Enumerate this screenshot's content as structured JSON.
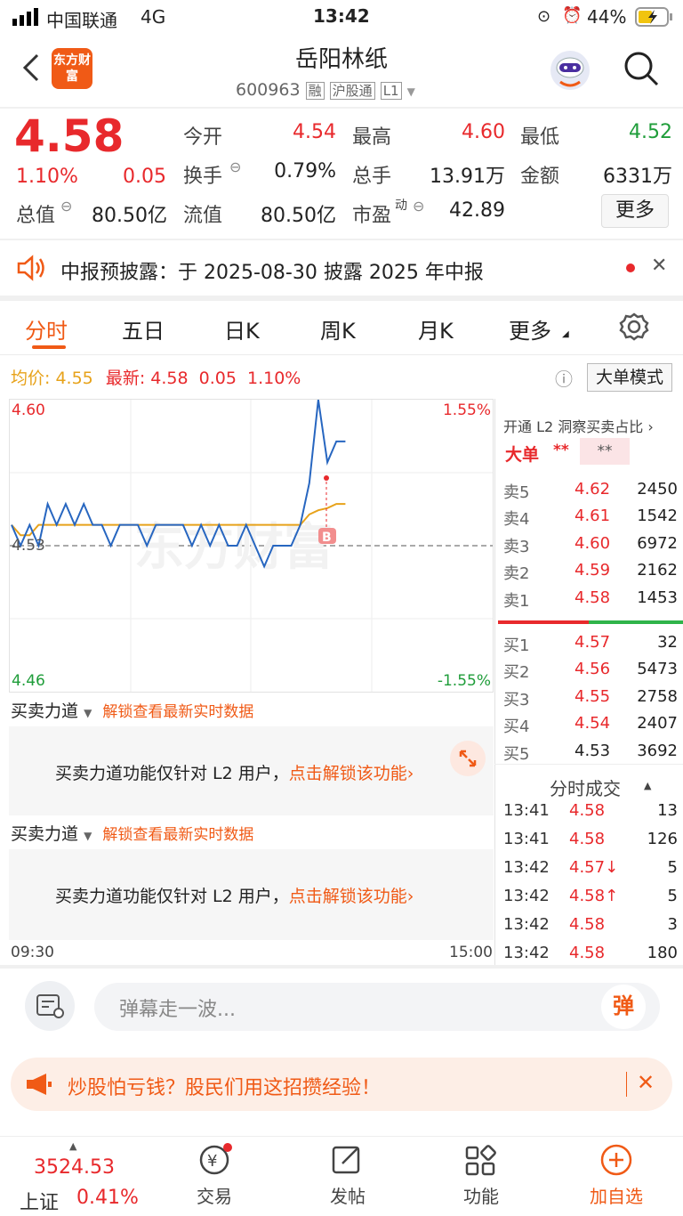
{
  "status_bar": {
    "carrier": "中国联通",
    "network": "4G",
    "time": "13:42",
    "battery": "44%"
  },
  "header": {
    "logo": "东方财富",
    "title": "岳阳林纸",
    "code": "600963",
    "tags": [
      "融",
      "沪股通",
      "L1"
    ]
  },
  "quote": {
    "price": "4.58",
    "change_pct": "1.10%",
    "change": "0.05",
    "open_label": "今开",
    "open": "4.54",
    "high_label": "最高",
    "high": "4.60",
    "low_label": "最低",
    "low": "4.52",
    "turnover_label": "换手",
    "turnover": "0.79%",
    "volume_label": "总手",
    "volume": "13.91万",
    "amount_label": "金额",
    "amount": "6331万",
    "mktcap_label": "总值",
    "mktcap": "80.50亿",
    "float_label": "流值",
    "float": "80.50亿",
    "pe_label": "市盈",
    "pe_sup": "动",
    "pe": "42.89",
    "more_button": "更多"
  },
  "notice": {
    "text": "中报预披露：于 2025-08-30 披露 2025 年中报"
  },
  "tabs": [
    "分时",
    "五日",
    "日K",
    "周K",
    "月K",
    "更多"
  ],
  "chart_header": {
    "avg_label": "均价:",
    "avg": "4.55",
    "latest_label": "最新:",
    "latest": "4.58",
    "chg": "0.05",
    "chg_pct": "1.10%",
    "mode_button": "大单模式"
  },
  "chart_data": {
    "type": "line",
    "y_top": "4.60",
    "y_bottom": "4.46",
    "y_mid": "4.53",
    "pct_top": "1.55%",
    "pct_bottom": "-1.55%",
    "x_start": "09:30",
    "x_end": "15:00",
    "ylim": [
      4.46,
      4.6
    ],
    "price_series": [
      4.54,
      4.53,
      4.54,
      4.53,
      4.55,
      4.54,
      4.55,
      4.54,
      4.55,
      4.54,
      4.54,
      4.53,
      4.54,
      4.54,
      4.54,
      4.53,
      4.54,
      4.54,
      4.54,
      4.54,
      4.53,
      4.54,
      4.53,
      4.54,
      4.53,
      4.53,
      4.54,
      4.53,
      4.52,
      4.53,
      4.53,
      4.53,
      4.54,
      4.56,
      4.6,
      4.57,
      4.58,
      4.58
    ],
    "avg_series": [
      4.54,
      4.535,
      4.535,
      4.54,
      4.54,
      4.54,
      4.54,
      4.54,
      4.54,
      4.54,
      4.54,
      4.54,
      4.54,
      4.54,
      4.54,
      4.54,
      4.54,
      4.54,
      4.54,
      4.54,
      4.54,
      4.54,
      4.54,
      4.54,
      4.54,
      4.54,
      4.54,
      4.54,
      4.54,
      4.54,
      4.54,
      4.54,
      4.54,
      4.545,
      4.547,
      4.548,
      4.55,
      4.55
    ]
  },
  "order_book": {
    "title": "开通 L2 洞察买卖占比",
    "big_label": "大单",
    "big_val1": "**",
    "big_val2": "**",
    "asks": [
      {
        "label": "卖5",
        "price": "4.62",
        "vol": "2450"
      },
      {
        "label": "卖4",
        "price": "4.61",
        "vol": "1542"
      },
      {
        "label": "卖3",
        "price": "4.60",
        "vol": "6972"
      },
      {
        "label": "卖2",
        "price": "4.59",
        "vol": "2162"
      },
      {
        "label": "卖1",
        "price": "4.58",
        "vol": "1453"
      }
    ],
    "bids": [
      {
        "label": "买1",
        "price": "4.57",
        "vol": "32"
      },
      {
        "label": "买2",
        "price": "4.56",
        "vol": "5473"
      },
      {
        "label": "买3",
        "price": "4.55",
        "vol": "2758"
      },
      {
        "label": "买4",
        "price": "4.54",
        "vol": "2407"
      },
      {
        "label": "买5",
        "price": "4.53",
        "vol": "3692"
      }
    ]
  },
  "ticks": {
    "title": "分时成交",
    "rows": [
      {
        "time": "13:41",
        "price": "4.58",
        "vol": "13"
      },
      {
        "time": "13:41",
        "price": "4.58",
        "vol": "126"
      },
      {
        "time": "13:42",
        "price": "4.57↓",
        "vol": "5"
      },
      {
        "time": "13:42",
        "price": "4.58↑",
        "vol": "5"
      },
      {
        "time": "13:42",
        "price": "4.58",
        "vol": "3"
      },
      {
        "time": "13:42",
        "price": "4.58",
        "vol": "180"
      }
    ]
  },
  "indicator": {
    "name": "买卖力道",
    "unlock_link": "解锁查看最新实时数据",
    "msg": "买卖力道功能仅针对 L2 用户，",
    "msg_link": "点击解锁该功能"
  },
  "danmaku": {
    "placeholder": "弹幕走一波...",
    "button": "弹"
  },
  "promo": {
    "text": "炒股怕亏钱？股民们用这招攒经验！"
  },
  "bottom_nav": {
    "index_value": "3524.53",
    "index_name": "上证",
    "index_pct": "0.41%",
    "items": [
      "交易",
      "发帖",
      "功能",
      "加自选"
    ]
  }
}
